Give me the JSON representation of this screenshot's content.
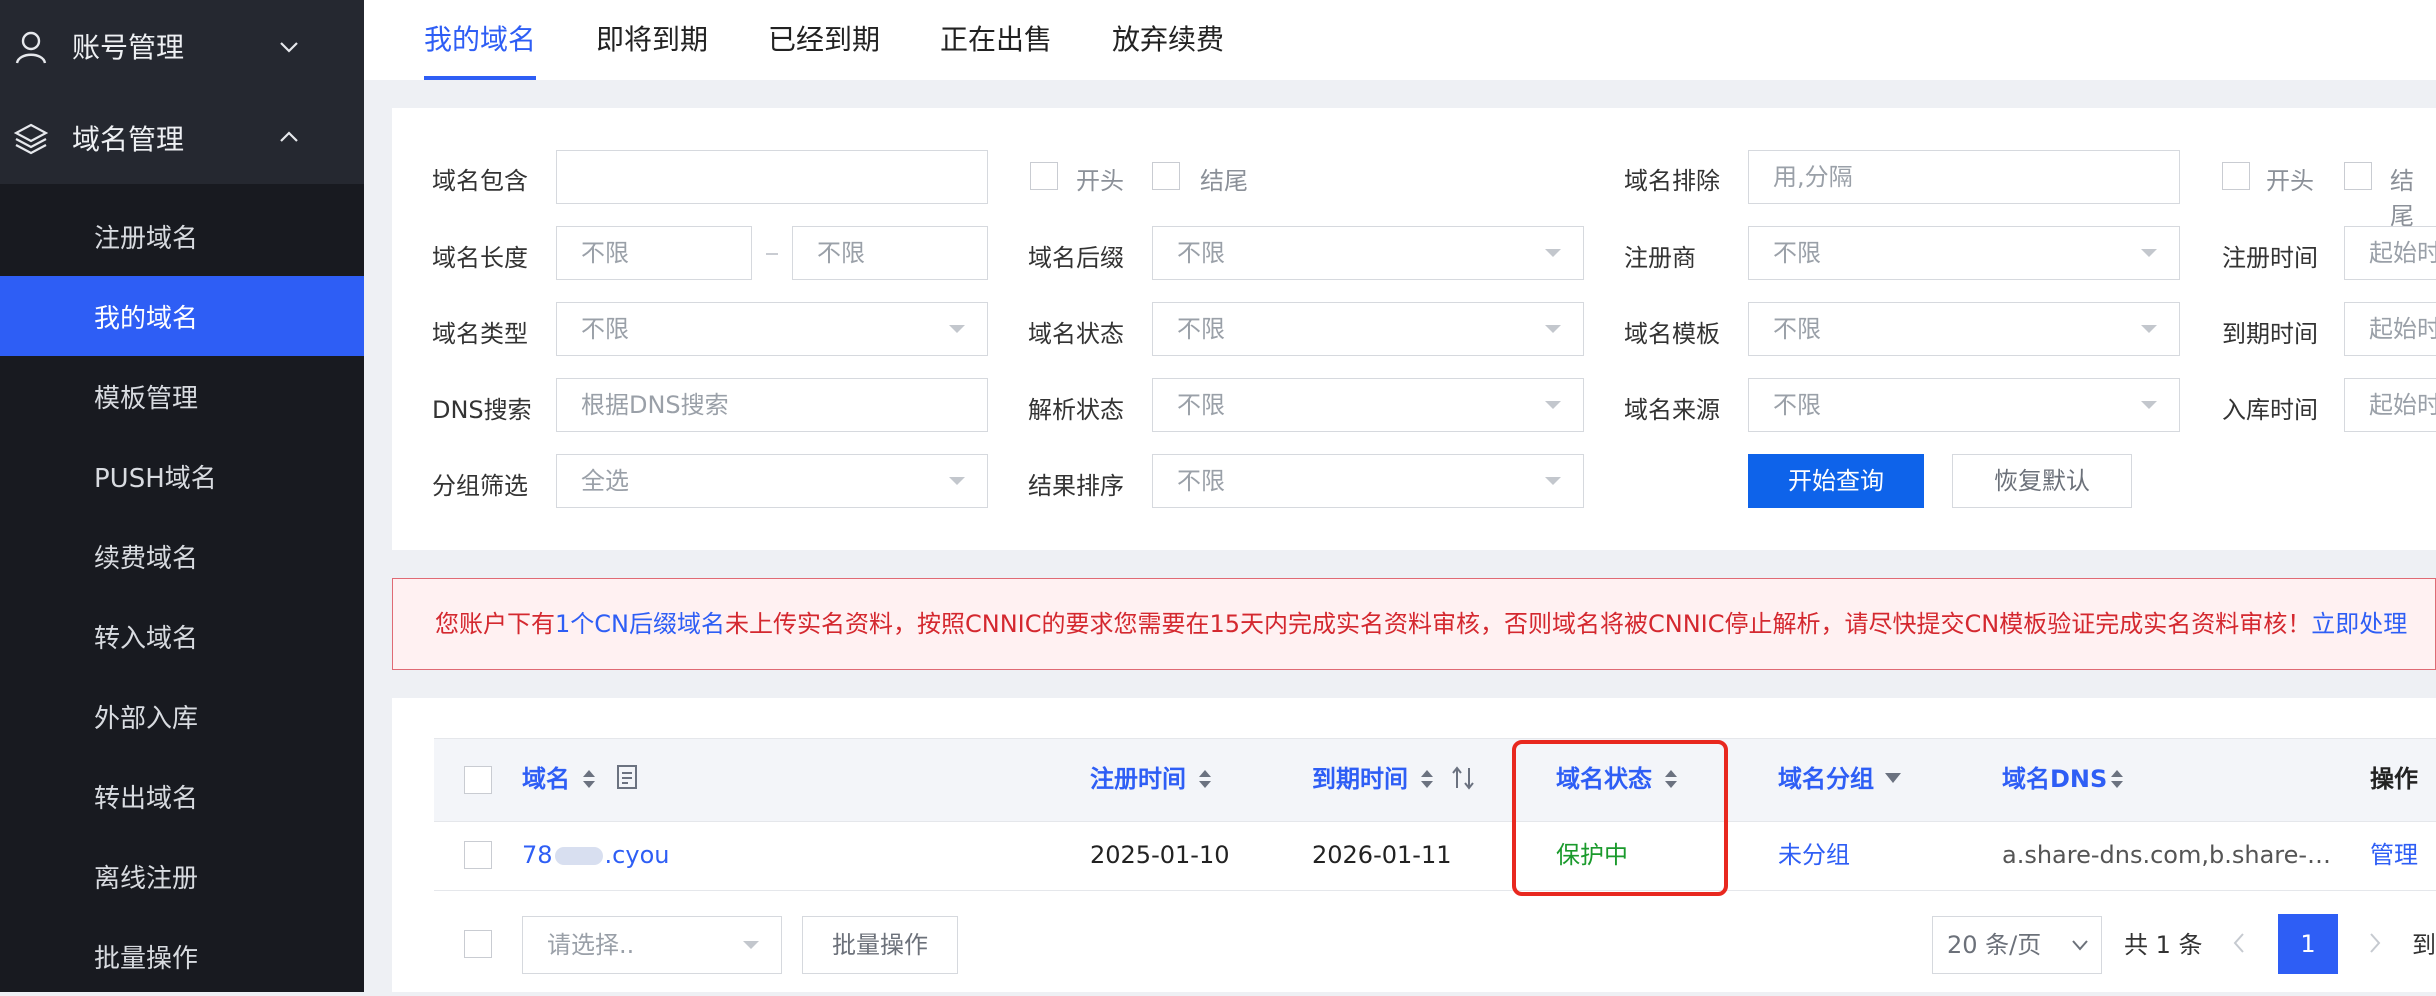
{
  "sidebar": {
    "groups": [
      {
        "label": "账号管理",
        "icon": "user-icon",
        "chevron": "chevron-down-icon"
      },
      {
        "label": "域名管理",
        "icon": "layers-icon",
        "chevron": "chevron-up-icon"
      }
    ],
    "items": [
      "注册域名",
      "我的域名",
      "模板管理",
      "PUSH域名",
      "续费域名",
      "转入域名",
      "外部入库",
      "转出域名",
      "离线注册",
      "批量操作"
    ],
    "active_index": 1
  },
  "tabs": [
    "我的域名",
    "即将到期",
    "已经到期",
    "正在出售",
    "放弃续费"
  ],
  "filters": {
    "contain_label": "域名包含",
    "contain_value": "",
    "begin_label": "开头",
    "end_label": "结尾",
    "exclude_label": "域名排除",
    "exclude_placeholder": "用,分隔",
    "begin_label_2": "开头",
    "end_label_2": "结尾",
    "length_label": "域名长度",
    "length_min_placeholder": "不限",
    "length_max_placeholder": "不限",
    "suffix_label": "域名后缀",
    "suffix_value": "不限",
    "registrar_label": "注册商",
    "registrar_value": "不限",
    "reg_time_label": "注册时间",
    "reg_time_placeholder": "起始时",
    "type_label": "域名类型",
    "type_value": "不限",
    "status_label": "域名状态",
    "status_value": "不限",
    "template_label": "域名模板",
    "template_value": "不限",
    "expire_time_label": "到期时间",
    "expire_time_placeholder": "起始时",
    "dns_label": "DNS搜索",
    "dns_placeholder": "根据DNS搜索",
    "resolve_label": "解析状态",
    "resolve_value": "不限",
    "source_label": "域名来源",
    "source_value": "不限",
    "import_time_label": "入库时间",
    "import_time_placeholder": "起始时",
    "group_label": "分组筛选",
    "group_value": "全选",
    "sort_label": "结果排序",
    "sort_value": "不限",
    "query_button": "开始查询",
    "reset_button": "恢复默认"
  },
  "notice": {
    "prefix": "您账户下有",
    "link1": "1个CN后缀域名",
    "middle": "未上传实名资料，按照CNNIC的要求您需要在15天内完成实名资料审核，否则域名将被CNNIC停止解析，请尽快提交CN模板验证完成实名资料审核！",
    "link2": "立即处理"
  },
  "table": {
    "headers": {
      "domain": "域名",
      "reg_time": "注册时间",
      "expire_time": "到期时间",
      "status": "域名状态",
      "group": "域名分组",
      "dns": "域名DNS",
      "action": "操作"
    },
    "rows": [
      {
        "domain_prefix": "78",
        "domain_suffix": ".cyou",
        "reg_time": "2025-01-10",
        "expire_time": "2026-01-11",
        "status": "保护中",
        "group": "未分组",
        "dns": "a.share-dns.com,b.share-…",
        "action": "管理"
      }
    ]
  },
  "footer": {
    "select_placeholder": "请选择..",
    "batch_button": "批量操作",
    "page_size": "20 条/页",
    "total": "共 1 条",
    "current_page": "1",
    "goto_label": "到"
  },
  "colors": {
    "accent": "#2e5ef5",
    "status_green": "#1a9a2c",
    "alert_red": "#d4282f",
    "highlight_box": "#e8281f"
  }
}
